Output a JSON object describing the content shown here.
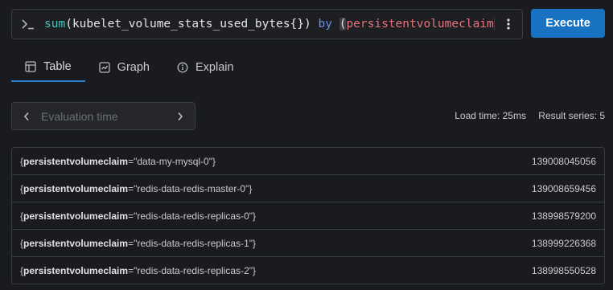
{
  "query": {
    "prompt_icon": "terminal-prompt-icon",
    "function": "sum",
    "open_paren": "(",
    "metric": "kubelet_volume_stats_used_bytes{}",
    "close_paren": ")",
    "keyword": "by",
    "group_open": "(",
    "group_label": "persistentvolumeclaim",
    "group_close": ")",
    "menu_icon": "kebab-menu-icon"
  },
  "execute_label": "Execute",
  "tabs": [
    {
      "label": "Table",
      "icon": "table-icon",
      "active": true
    },
    {
      "label": "Graph",
      "icon": "graph-icon",
      "active": false
    },
    {
      "label": "Explain",
      "icon": "info-icon",
      "active": false
    }
  ],
  "evaluation": {
    "placeholder": "Evaluation time",
    "prev_icon": "chevron-left-icon",
    "next_icon": "chevron-right-icon"
  },
  "stats": {
    "load_time": "Load time: 25ms",
    "result_series": "Result series: 5"
  },
  "results": [
    {
      "open": "{",
      "label_name": "persistentvolumeclaim",
      "eq": "=",
      "label_value": "\"data-my-mysql-0\"",
      "close": "}",
      "value": "139008045056"
    },
    {
      "open": "{",
      "label_name": "persistentvolumeclaim",
      "eq": "=",
      "label_value": "\"redis-data-redis-master-0\"",
      "close": "}",
      "value": "139008659456"
    },
    {
      "open": "{",
      "label_name": "persistentvolumeclaim",
      "eq": "=",
      "label_value": "\"redis-data-redis-replicas-0\"",
      "close": "}",
      "value": "138998579200"
    },
    {
      "open": "{",
      "label_name": "persistentvolumeclaim",
      "eq": "=",
      "label_value": "\"redis-data-redis-replicas-1\"",
      "close": "}",
      "value": "138999226368"
    },
    {
      "open": "{",
      "label_name": "persistentvolumeclaim",
      "eq": "=",
      "label_value": "\"redis-data-redis-replicas-2\"",
      "close": "}",
      "value": "138998550528"
    }
  ],
  "colors": {
    "background": "#1a1b1e",
    "accent": "#1971c2",
    "function": "#3ec7c0",
    "keyword": "#6d8fe8",
    "label": "#e7737f"
  }
}
